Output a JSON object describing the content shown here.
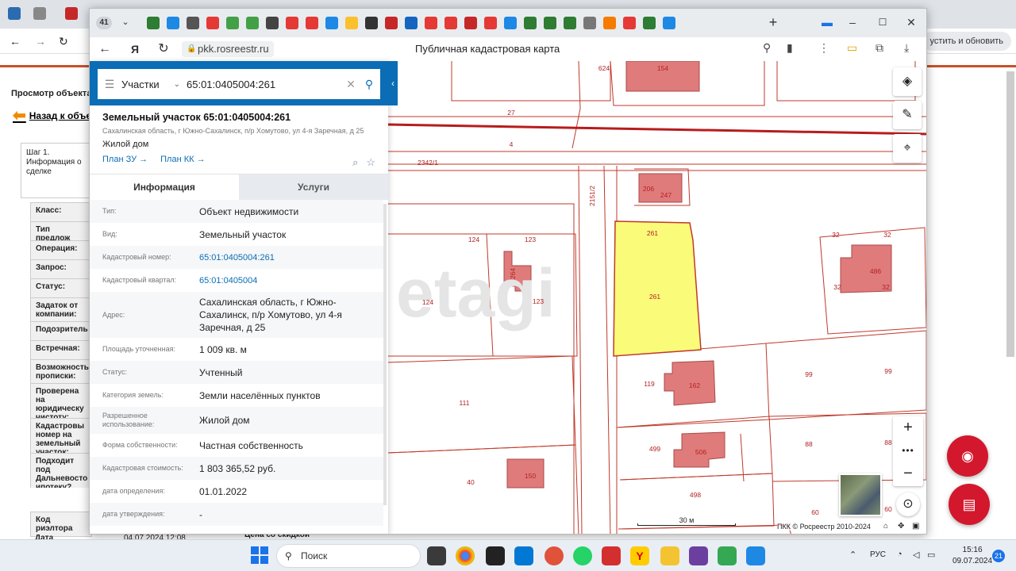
{
  "background_page": {
    "update_button": "устить и обновить",
    "page_title": "Просмотр объекта",
    "back_link": "Назад к объе",
    "step": "Шаг 1. Информация о сделке",
    "form_labels": [
      "Класс:",
      "Тип предлож",
      "Операция:",
      "Запрос:",
      "Статус:",
      "Задаток от компании:",
      "Подозритель",
      "Встречная:",
      "Возможность прописки:",
      "Проверена на юридическу чистоту:",
      "Кадастровы номер на земельный участок:",
      "Подходит под Дальневосто ипотеку?"
    ],
    "realtor_code_label": "Код риэлтора",
    "created_label": "Дата создания",
    "created_value": "04.07.2024 12:08",
    "discount_label": "Цена со скидкой"
  },
  "popup": {
    "tab_counter": "41",
    "url": "pkk.rosreestr.ru",
    "title": "Публичная кадастровая карта"
  },
  "search": {
    "type_label": "Участки",
    "query": "65:01:0405004:261"
  },
  "object": {
    "title": "Земельный участок 65:01:0405004:261",
    "address_short": "Сахалинская область, г Южно-Сахалинск, п/р Хомутово, ул 4-я Заречная, д 25",
    "use": "Жилой дом",
    "link_plan_zu": "План ЗУ →",
    "link_plan_kk": "План КК →"
  },
  "tabs": {
    "info": "Информация",
    "services": "Услуги"
  },
  "info": [
    {
      "label": "Тип:",
      "value": "Объект недвижимости"
    },
    {
      "label": "Вид:",
      "value": "Земельный участок"
    },
    {
      "label": "Кадастровый номер:",
      "value": "65:01:0405004:261"
    },
    {
      "label": "Кадастровый квартал:",
      "value": "65:01:0405004"
    },
    {
      "label": "Адрес:",
      "value": "Сахалинская область, г Южно-Сахалинск, п/р Хомутово, ул 4-я Заречная, д 25"
    },
    {
      "label": "Площадь уточненная:",
      "value": "1 009 кв. м"
    },
    {
      "label": "Статус:",
      "value": "Учтенный"
    },
    {
      "label": "Категория земель:",
      "value": "Земли населённых пунктов"
    },
    {
      "label": "Разрешенное использование:",
      "value": "Жилой дом"
    },
    {
      "label": "Форма собственности:",
      "value": "Частная собственность"
    },
    {
      "label": "Кадастровая стоимость:",
      "value": "1 803 365,52 руб."
    },
    {
      "label": "дата определения:",
      "value": "01.01.2022"
    },
    {
      "label": "дата утверждения:",
      "value": "-"
    }
  ],
  "map": {
    "labels": [
      "154",
      "624",
      "27",
      "4",
      "2342/1",
      "2151/2",
      "206",
      "247",
      "261",
      "261",
      "124",
      "123",
      "264",
      "123",
      "124",
      "32",
      "32",
      "32",
      "32",
      "486",
      "119",
      "162",
      "99",
      "99",
      "111",
      "499",
      "506",
      "88",
      "88",
      "40",
      "150",
      "498",
      "60",
      "60"
    ],
    "scale_label": "30 м",
    "copyright": "ПКК © Росреестр 2010-2024",
    "watermark": "etagi"
  },
  "taskbar": {
    "search_label": "Поиск",
    "lang": "РУС",
    "time": "15:16",
    "date": "09.07.2024",
    "notif_count": "21"
  },
  "colors": {
    "brand_blue": "#0a6db5",
    "parcel_selected": "#fbfb7a",
    "building": "#e07b7b",
    "boundary": "#c0392b",
    "fab_red": "#d3182d"
  }
}
